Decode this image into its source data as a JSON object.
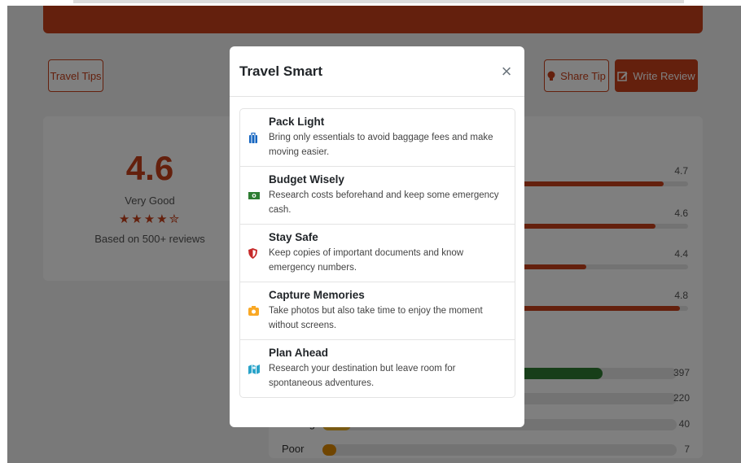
{
  "background": {
    "travel_tips_button": "Travel Tips",
    "share_tip_button": "Share Tip",
    "write_review_button": "Write Review",
    "rating": {
      "score": "4.6",
      "label": "Very Good",
      "stars": "★★★★✮",
      "basis": "Based on 500+ reviews"
    },
    "category_ratings": [
      {
        "value": "4.7",
        "fraction": 0.94
      },
      {
        "value": "4.6",
        "fraction": 0.92
      },
      {
        "value": "4.4",
        "fraction": 0.75
      },
      {
        "value": "4.8",
        "fraction": 0.98
      }
    ],
    "distribution": [
      {
        "label": "",
        "count": "397",
        "fraction": 0.79,
        "color": "#2e7d32"
      },
      {
        "label": "",
        "count": "220",
        "fraction": 0.44,
        "color": "#c8401b"
      },
      {
        "label": "Average",
        "count": "40",
        "fraction": 0.08,
        "color": "#f0b429"
      },
      {
        "label": "Poor",
        "count": "7",
        "fraction": 0.04,
        "color": "#e08a00"
      }
    ]
  },
  "modal": {
    "title": "Travel Smart",
    "close_symbol": "×",
    "tips": [
      {
        "icon": "suitcase-icon",
        "title": "Pack Light",
        "description": "Bring only essentials to avoid baggage fees and make moving easier."
      },
      {
        "icon": "money-icon",
        "title": "Budget Wisely",
        "description": "Research costs beforehand and keep some emergency cash."
      },
      {
        "icon": "shield-icon",
        "title": "Stay Safe",
        "description": "Keep copies of important documents and know emergency numbers."
      },
      {
        "icon": "camera-icon",
        "title": "Capture Memories",
        "description": "Take photos but also take time to enjoy the moment without screens."
      },
      {
        "icon": "map-icon",
        "title": "Plan Ahead",
        "description": "Research your destination but leave room for spontaneous adventures."
      }
    ]
  },
  "colors": {
    "accent": "#c8401b",
    "suitcase": "#1565c0",
    "money": "#2e7d32",
    "shield": "#c62828",
    "camera": "#f9a825",
    "map": "#29a3c9"
  }
}
